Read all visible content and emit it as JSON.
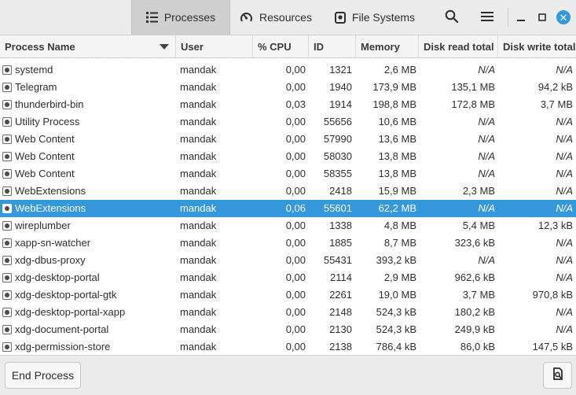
{
  "header": {
    "tabs": [
      {
        "label": "Processes",
        "icon": "list-icon"
      },
      {
        "label": "Resources",
        "icon": "gauge-icon"
      },
      {
        "label": "File Systems",
        "icon": "disk-icon"
      }
    ],
    "active_tab": "Processes",
    "close_glyph": "✕"
  },
  "columns": [
    "Process Name",
    "User",
    "% CPU",
    "ID",
    "Memory",
    "Disk read total",
    "Disk write total"
  ],
  "rows": [
    {
      "name": "systemd",
      "user": "mandak",
      "cpu": "0,00",
      "id": "1321",
      "mem": "2,6 MB",
      "dr": "N/A",
      "dw": "N/A"
    },
    {
      "name": "Telegram",
      "user": "mandak",
      "cpu": "0,00",
      "id": "1940",
      "mem": "173,9 MB",
      "dr": "135,1 MB",
      "dw": "94,2 kB"
    },
    {
      "name": "thunderbird-bin",
      "user": "mandak",
      "cpu": "0,03",
      "id": "1914",
      "mem": "198,8 MB",
      "dr": "172,8 MB",
      "dw": "3,7 MB"
    },
    {
      "name": "Utility Process",
      "user": "mandak",
      "cpu": "0,00",
      "id": "55656",
      "mem": "10,6 MB",
      "dr": "N/A",
      "dw": "N/A"
    },
    {
      "name": "Web Content",
      "user": "mandak",
      "cpu": "0,00",
      "id": "57990",
      "mem": "13,6 MB",
      "dr": "N/A",
      "dw": "N/A"
    },
    {
      "name": "Web Content",
      "user": "mandak",
      "cpu": "0,00",
      "id": "58030",
      "mem": "13,8 MB",
      "dr": "N/A",
      "dw": "N/A"
    },
    {
      "name": "Web Content",
      "user": "mandak",
      "cpu": "0,00",
      "id": "58355",
      "mem": "13,8 MB",
      "dr": "N/A",
      "dw": "N/A"
    },
    {
      "name": "WebExtensions",
      "user": "mandak",
      "cpu": "0,00",
      "id": "2418",
      "mem": "15,9 MB",
      "dr": "2,3 MB",
      "dw": "N/A"
    },
    {
      "name": "WebExtensions",
      "user": "mandak",
      "cpu": "0,06",
      "id": "55601",
      "mem": "62,2 MB",
      "dr": "N/A",
      "dw": "N/A",
      "selected": true
    },
    {
      "name": "wireplumber",
      "user": "mandak",
      "cpu": "0,00",
      "id": "1338",
      "mem": "4,8 MB",
      "dr": "5,4 MB",
      "dw": "12,3 kB"
    },
    {
      "name": "xapp-sn-watcher",
      "user": "mandak",
      "cpu": "0,00",
      "id": "1885",
      "mem": "8,7 MB",
      "dr": "323,6 kB",
      "dw": "N/A"
    },
    {
      "name": "xdg-dbus-proxy",
      "user": "mandak",
      "cpu": "0,00",
      "id": "55431",
      "mem": "393,2 kB",
      "dr": "N/A",
      "dw": "N/A"
    },
    {
      "name": "xdg-desktop-portal",
      "user": "mandak",
      "cpu": "0,00",
      "id": "2114",
      "mem": "2,9 MB",
      "dr": "962,6 kB",
      "dw": "N/A"
    },
    {
      "name": "xdg-desktop-portal-gtk",
      "user": "mandak",
      "cpu": "0,00",
      "id": "2261",
      "mem": "19,0 MB",
      "dr": "3,7 MB",
      "dw": "970,8 kB"
    },
    {
      "name": "xdg-desktop-portal-xapp",
      "user": "mandak",
      "cpu": "0,00",
      "id": "2148",
      "mem": "524,3 kB",
      "dr": "180,2 kB",
      "dw": "N/A"
    },
    {
      "name": "xdg-document-portal",
      "user": "mandak",
      "cpu": "0,00",
      "id": "2130",
      "mem": "524,3 kB",
      "dr": "249,9 kB",
      "dw": "N/A"
    },
    {
      "name": "xdg-permission-store",
      "user": "mandak",
      "cpu": "0,00",
      "id": "2138",
      "mem": "786,4 kB",
      "dr": "86,0 kB",
      "dw": "147,5 kB"
    }
  ],
  "footer": {
    "end_process_label": "End Process"
  },
  "colors": {
    "selection": "#3598db",
    "close_button": "#3598db"
  }
}
